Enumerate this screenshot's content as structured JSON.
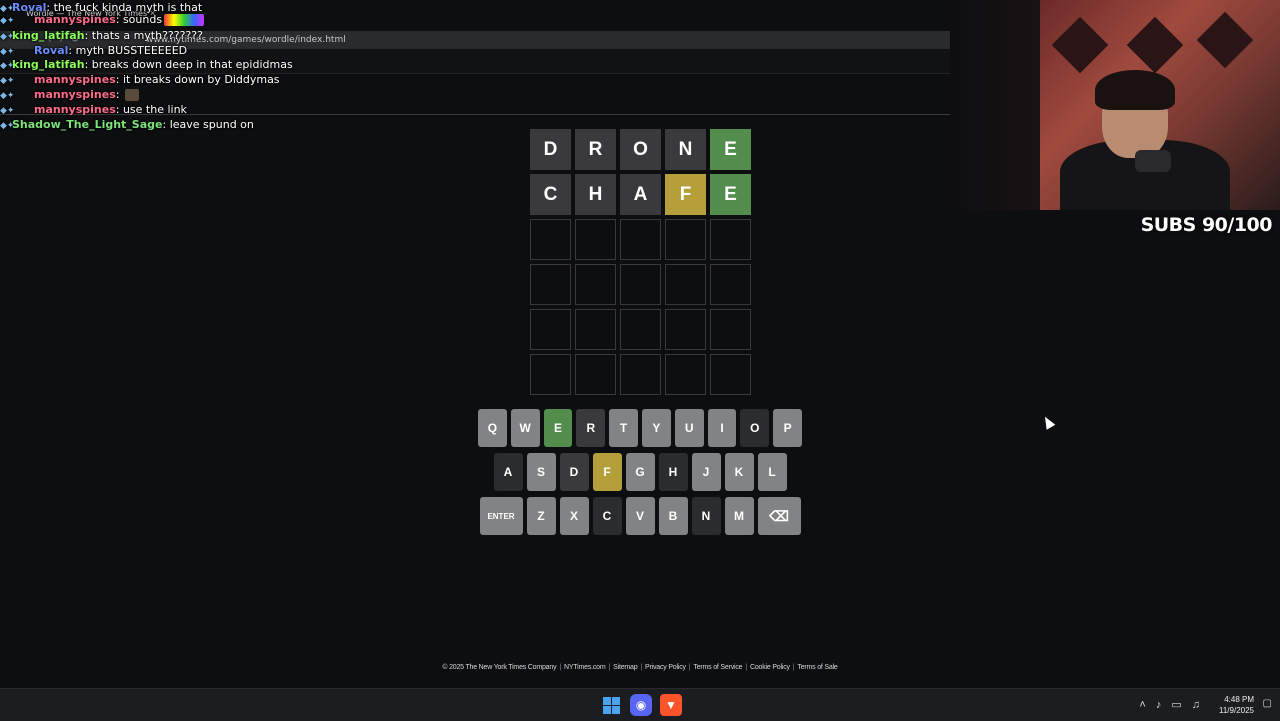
{
  "browser": {
    "tab_title": "Wordle — The New York Times",
    "tab_close": "×",
    "url": "www.nytimes.com/games/wordle/index.html"
  },
  "chat": [
    {
      "user": "Roval",
      "color": "#6a8cff",
      "message": "the fuck kinda myth is that"
    },
    {
      "user": "mannyspines",
      "color": "#ff6b8a",
      "message": "sounds"
    },
    {
      "user": "king_latifah",
      "color": "#8cff5a",
      "message": "thats a myth???????"
    },
    {
      "user": "Roval",
      "color": "#6a8cff",
      "message": "myth BUSSTEEEEED"
    },
    {
      "user": "king_latifah",
      "color": "#8cff5a",
      "message": "breaks down deep in that epididmas"
    },
    {
      "user": "mannyspines",
      "color": "#ff6b8a",
      "message": "it breaks down by Diddymas"
    },
    {
      "user": "mannyspines",
      "color": "#ff6b8a",
      "message": ""
    },
    {
      "user": "mannyspines",
      "color": "#ff6b8a",
      "message": "use the link"
    },
    {
      "user": "Shadow_The_Light_Sage",
      "color": "#7de37a",
      "message": "leave spund on"
    }
  ],
  "board": {
    "rows": [
      [
        {
          "l": "D",
          "s": "absent"
        },
        {
          "l": "R",
          "s": "absent"
        },
        {
          "l": "O",
          "s": "absent"
        },
        {
          "l": "N",
          "s": "absent"
        },
        {
          "l": "E",
          "s": "correct"
        }
      ],
      [
        {
          "l": "C",
          "s": "absent"
        },
        {
          "l": "H",
          "s": "absent"
        },
        {
          "l": "A",
          "s": "absent"
        },
        {
          "l": "F",
          "s": "present"
        },
        {
          "l": "E",
          "s": "correct"
        }
      ],
      [
        {
          "l": "",
          "s": "empty"
        },
        {
          "l": "",
          "s": "empty"
        },
        {
          "l": "",
          "s": "empty"
        },
        {
          "l": "",
          "s": "empty"
        },
        {
          "l": "",
          "s": "empty"
        }
      ],
      [
        {
          "l": "",
          "s": "empty"
        },
        {
          "l": "",
          "s": "empty"
        },
        {
          "l": "",
          "s": "empty"
        },
        {
          "l": "",
          "s": "empty"
        },
        {
          "l": "",
          "s": "empty"
        }
      ],
      [
        {
          "l": "",
          "s": "empty"
        },
        {
          "l": "",
          "s": "empty"
        },
        {
          "l": "",
          "s": "empty"
        },
        {
          "l": "",
          "s": "empty"
        },
        {
          "l": "",
          "s": "empty"
        }
      ],
      [
        {
          "l": "",
          "s": "empty"
        },
        {
          "l": "",
          "s": "empty"
        },
        {
          "l": "",
          "s": "empty"
        },
        {
          "l": "",
          "s": "empty"
        },
        {
          "l": "",
          "s": "empty"
        }
      ]
    ]
  },
  "keyboard": {
    "rows": [
      [
        {
          "k": "Q",
          "s": "unused"
        },
        {
          "k": "W",
          "s": "unused"
        },
        {
          "k": "E",
          "s": "correct"
        },
        {
          "k": "R",
          "s": "absent"
        },
        {
          "k": "T",
          "s": "unused"
        },
        {
          "k": "Y",
          "s": "unused"
        },
        {
          "k": "U",
          "s": "unused"
        },
        {
          "k": "I",
          "s": "unused"
        },
        {
          "k": "O",
          "s": "dim"
        },
        {
          "k": "P",
          "s": "unused"
        }
      ],
      [
        {
          "k": "A",
          "s": "dim"
        },
        {
          "k": "S",
          "s": "unused"
        },
        {
          "k": "D",
          "s": "absent"
        },
        {
          "k": "F",
          "s": "present"
        },
        {
          "k": "G",
          "s": "unused"
        },
        {
          "k": "H",
          "s": "dim"
        },
        {
          "k": "J",
          "s": "unused"
        },
        {
          "k": "K",
          "s": "unused"
        },
        {
          "k": "L",
          "s": "unused"
        }
      ],
      [
        {
          "k": "ENTER",
          "s": "unused",
          "wide": true
        },
        {
          "k": "Z",
          "s": "unused"
        },
        {
          "k": "X",
          "s": "unused"
        },
        {
          "k": "C",
          "s": "dim"
        },
        {
          "k": "V",
          "s": "unused"
        },
        {
          "k": "B",
          "s": "unused"
        },
        {
          "k": "N",
          "s": "dim"
        },
        {
          "k": "M",
          "s": "unused"
        },
        {
          "k": "⌫",
          "s": "unused",
          "wide": true
        }
      ]
    ]
  },
  "footer": {
    "links": [
      "© 2025 The New York Times Company",
      "NYTimes.com",
      "Sitemap",
      "Privacy Policy",
      "Terms of Service",
      "Cookie Policy",
      "Terms of Sale"
    ]
  },
  "overlay": {
    "subs": "SUBS 90/100"
  },
  "taskbar": {
    "time": "4:48 PM",
    "date": "11/9/2025",
    "tray_icons": [
      "chevron-up-icon",
      "mic-icon",
      "network-icon",
      "volume-icon"
    ]
  },
  "colors": {
    "correct": "#538d4e",
    "present": "#b59f3b",
    "absent": "#3a3a3c",
    "unused": "#818384",
    "background": "#0d0e10"
  }
}
